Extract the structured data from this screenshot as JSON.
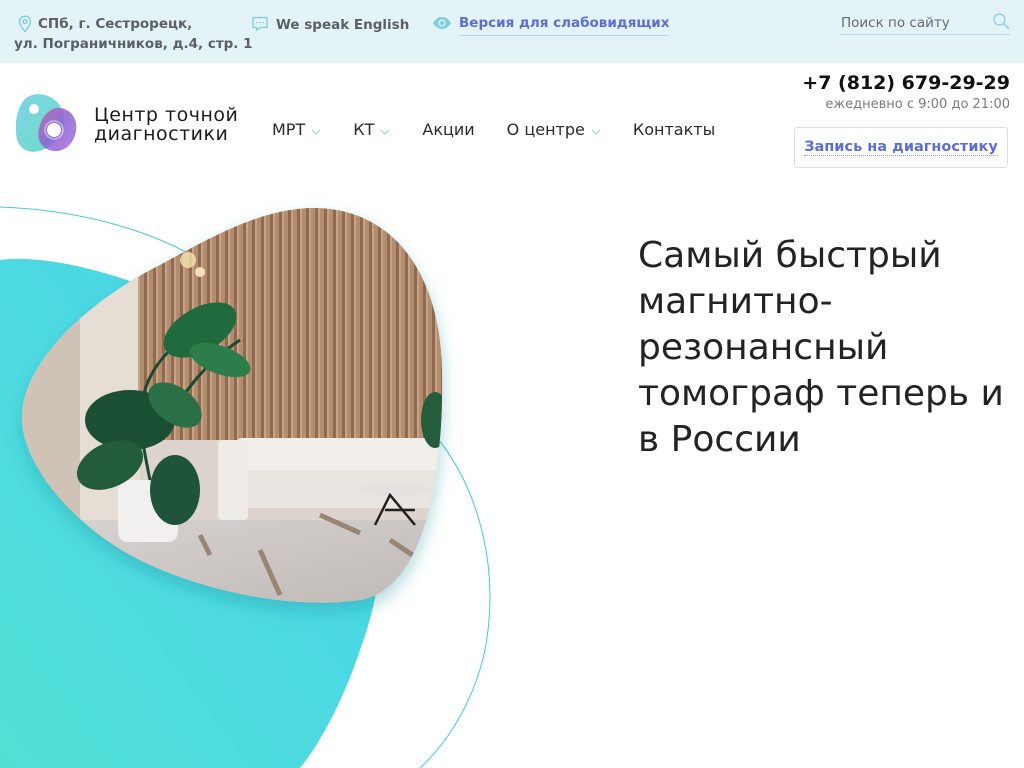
{
  "topbar": {
    "address_line1": "СПб, г. Сестрорецк,",
    "address_line2": "ул. Пограничников, д.4, стр. 1",
    "english_label": "We speak English",
    "low_vision_label": "Версия для слабовидящих",
    "search_placeholder": "Поиск по сайту",
    "icons": {
      "address": "map-pin-icon",
      "english": "chat-bubble-icon",
      "low_vision": "eye-icon",
      "search": "search-icon"
    }
  },
  "header": {
    "logo_line1": "Центр точной",
    "logo_line2": "диагностики",
    "nav": [
      {
        "label": "МРТ",
        "has_dropdown": true
      },
      {
        "label": "КТ",
        "has_dropdown": true
      },
      {
        "label": "Акции",
        "has_dropdown": false
      },
      {
        "label": "О центре",
        "has_dropdown": true
      },
      {
        "label": "Контакты",
        "has_dropdown": false
      }
    ],
    "phone": "+7 (812) 679-29-29",
    "hours": "ежедневно с 9:00 до 21:00",
    "cta_label": "Запись на диагностику"
  },
  "hero": {
    "title": "Самый быстрый магнитно-резонансный томограф теперь и в России",
    "image_alt": "Интерьер клиники: диван, растения, деревянные панели"
  },
  "colors": {
    "topbar_bg": "#e3f3f8",
    "accent_blue": "#5b6fd3",
    "teal": "#4dd9e0",
    "icon_teal": "#7dcfe0"
  }
}
